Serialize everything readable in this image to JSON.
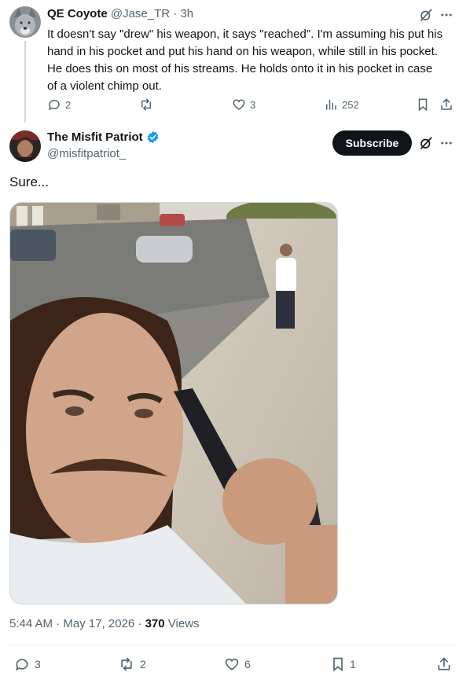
{
  "reply": {
    "author_name": "QE Coyote",
    "handle": "@Jase_TR",
    "dot": "·",
    "time": "3h",
    "text_lines": [
      "It doesn't say \"drew\" his weapon, it says \"reached\". I'm assuming his put his",
      "hand in his pocket and put his hand on his weapon, while still in his pocket.",
      "He does this on most of his streams. He holds onto it in his pocket in case",
      "of a violent chimp out."
    ],
    "actions": {
      "replies": "2",
      "reposts": "",
      "likes": "3",
      "views": "252"
    }
  },
  "post": {
    "author_name": "The Misfit Patriot",
    "handle": "@misfitpatriot_",
    "subscribe_label": "Subscribe",
    "text": "Sure...",
    "timestamp": "5:44 AM · May 17, 2026 · ",
    "views_count": "370",
    "views_label": " Views",
    "actions": {
      "replies": "3",
      "reposts": "2",
      "likes": "6",
      "bookmarks": "1"
    }
  },
  "colors": {
    "verified": "#1d9bf0",
    "text_muted": "#536471",
    "subscribe_bg": "#0f1419"
  }
}
